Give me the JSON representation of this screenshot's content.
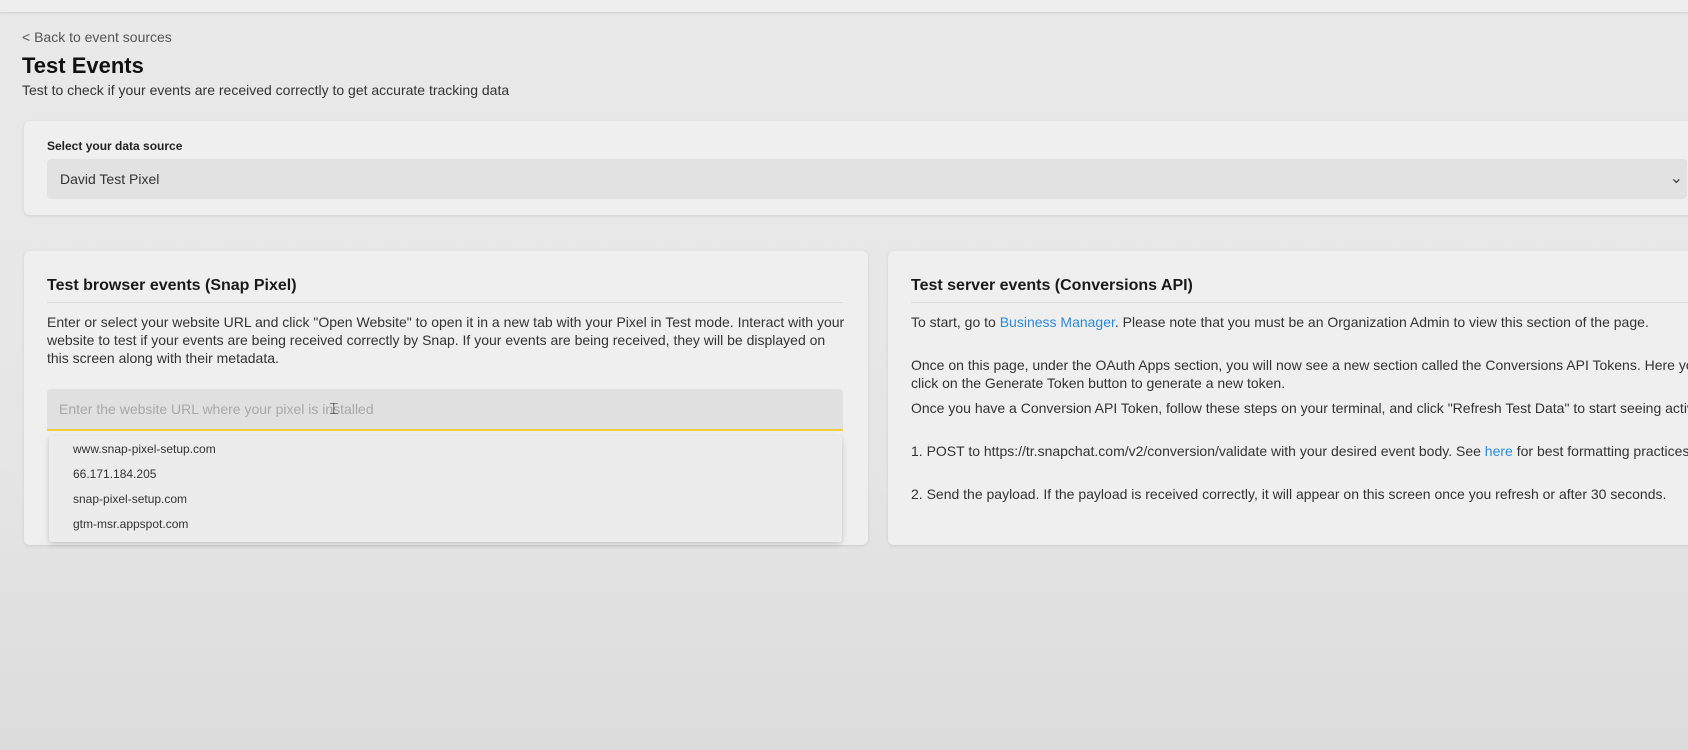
{
  "nav": {
    "back_label": "< Back to event sources"
  },
  "header": {
    "title": "Test Events",
    "subtitle": "Test to check if your events are received correctly to get accurate tracking data"
  },
  "data_source": {
    "label": "Select your data source",
    "selected": "David Test Pixel",
    "chevron_icon": "chevron-down-icon"
  },
  "browser_events": {
    "title": "Test browser events (Snap Pixel)",
    "description": "Enter or select your website URL and click \"Open Website\" to open it in a new tab with your Pixel in Test mode. Interact with your website to test if your events are being received correctly by Snap. If your events are being received, they will be displayed on this screen along with their metadata.",
    "url_input": {
      "value": "",
      "placeholder": "Enter the website URL where your pixel is installed"
    },
    "suggestions": [
      "www.snap-pixel-setup.com",
      "66.171.184.205",
      "snap-pixel-setup.com",
      "gtm-msr.appspot.com"
    ]
  },
  "server_events": {
    "title": "Test server events (Conversions API)",
    "p1_before": "To start, go to ",
    "p1_link": "Business Manager",
    "p1_after": ". Please note that you must be an Organization Admin to view this section of the page.",
    "p2": "Once on this page, under the OAuth Apps section, you will now see a new section called the Conversions API Tokens. Here you can click on the Generate Token button to generate a new token.",
    "p3": "Once you have a Conversion API Token, follow these steps on your terminal, and click \"Refresh Test Data\" to start seeing activity.",
    "p4_before": "1. POST to https://tr.snapchat.com/v2/conversion/validate with your desired event body. See ",
    "p4_link": "here",
    "p4_after": " for best formatting practices.",
    "p5": "2. Send the payload. If the payload is received correctly, it will appear on this screen once you refresh or after 30 seconds."
  },
  "colors": {
    "accent_underline": "#f2cf3a",
    "link": "#2e8ad8"
  }
}
